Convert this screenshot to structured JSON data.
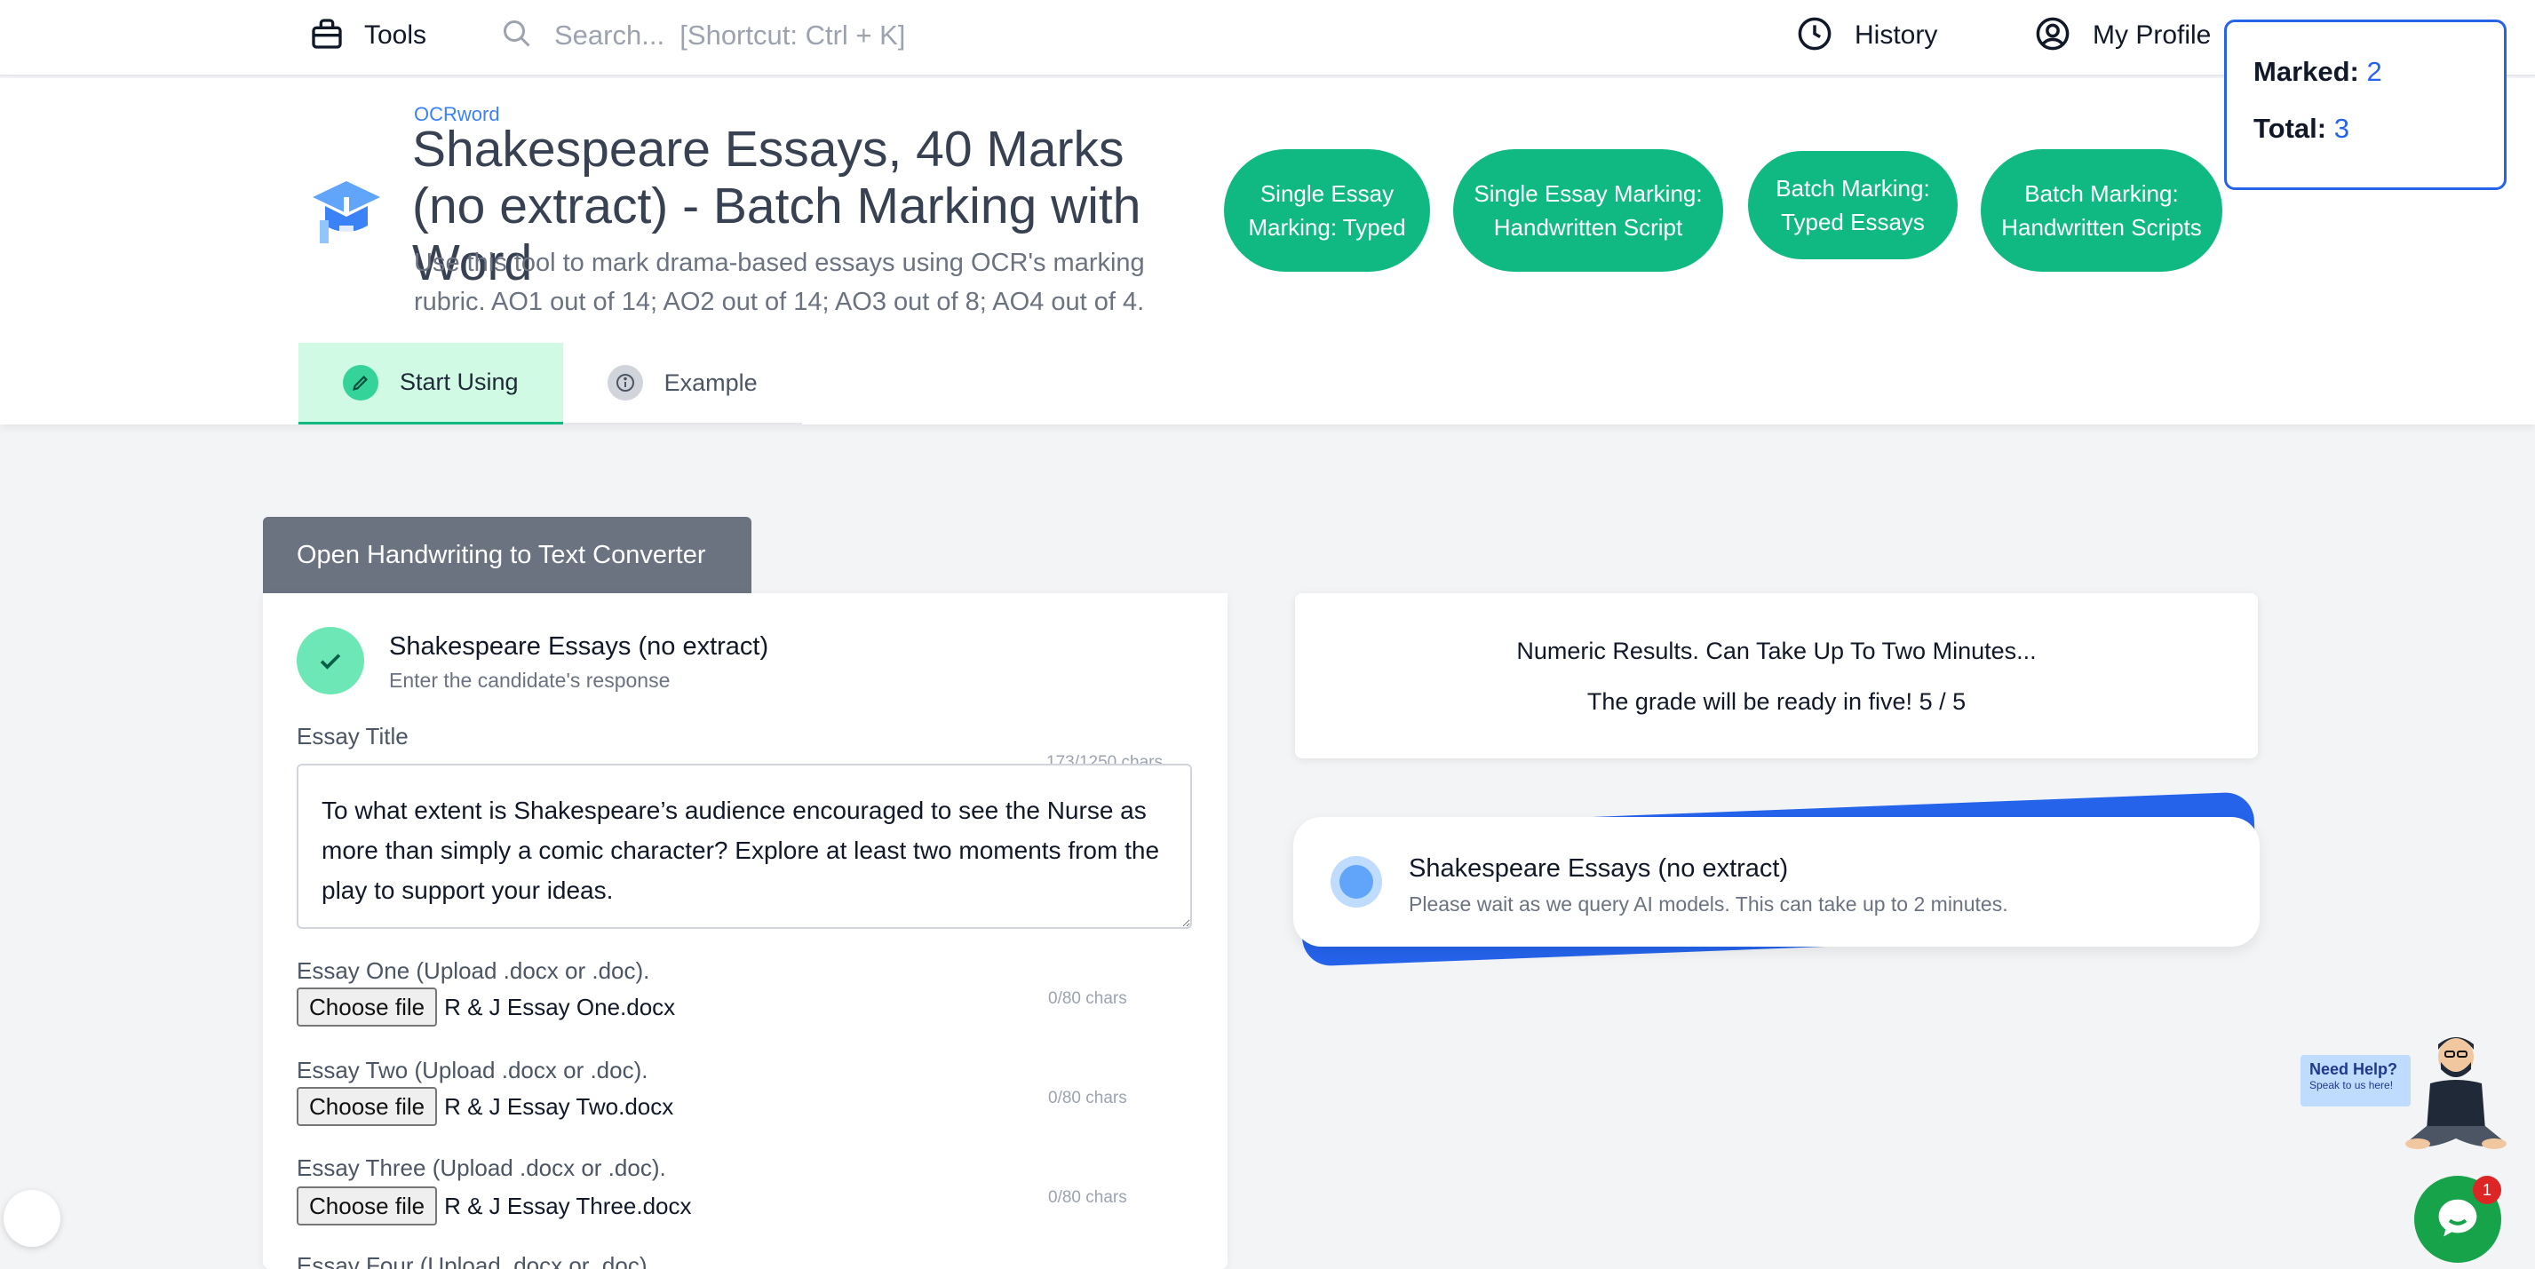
{
  "nav": {
    "tools_label": "Tools",
    "search_placeholder": "Search...  [Shortcut: Ctrl + K]",
    "history_label": "History",
    "profile_label": "My Profile"
  },
  "counter": {
    "marked_label": "Marked:",
    "marked_value": "2",
    "total_label": "Total:",
    "total_value": "3"
  },
  "header": {
    "brand": "OCRword",
    "title": "Shakespeare Essays, 40 Marks (no extract) - Batch Marking with Word",
    "description": "Use this tool to mark drama-based essays using OCR's marking rubric. AO1 out of 14; AO2 out of 14; AO3 out of 8; AO4 out of 4.",
    "pills": [
      "Single Essay Marking: Typed",
      "Single Essay Marking: Handwritten Script",
      "Batch Marking: Typed Essays",
      "Batch Marking: Handwritten Scripts"
    ],
    "tabs": [
      "Start Using",
      "Example"
    ]
  },
  "form": {
    "converter_button": "Open Handwriting to Text Converter",
    "heading": "Shakespeare Essays (no extract)",
    "subheading": "Enter the candidate's response",
    "essay_title_label": "Essay Title",
    "essay_title_count": "173/1250 chars",
    "essay_title_value": "To what extent is Shakespeare’s audience encouraged to see the Nurse as more than simply a comic character? Explore at least two moments from the play to support your ideas.",
    "choose_file_label": "Choose file",
    "uploads": [
      {
        "label": "Essay One (Upload .docx or .doc).",
        "file": "R & J Essay One.docx",
        "count": "0/80 chars"
      },
      {
        "label": "Essay Two (Upload .docx or .doc).",
        "file": "R & J Essay Two.docx",
        "count": "0/80 chars"
      },
      {
        "label": "Essay Three (Upload .docx or .doc).",
        "file": "R & J Essay Three.docx",
        "count": "0/80 chars"
      },
      {
        "label": "Essay Four (Upload .docx or .doc).",
        "file": "",
        "count": ""
      }
    ]
  },
  "results": {
    "line1": "Numeric Results. Can Take Up To Two Minutes...",
    "line2": "The grade will be ready in five! 5 / 5"
  },
  "loader": {
    "heading": "Shakespeare Essays (no extract)",
    "subheading": "Please wait as we query AI models. This can take up to 2 minutes."
  },
  "help": {
    "title": "Need Help?",
    "subtitle": "Speak to us here!",
    "badge": "1"
  },
  "colors": {
    "accent_green": "#10b981",
    "accent_blue": "#2563eb",
    "converter_gray": "#6b7280"
  }
}
